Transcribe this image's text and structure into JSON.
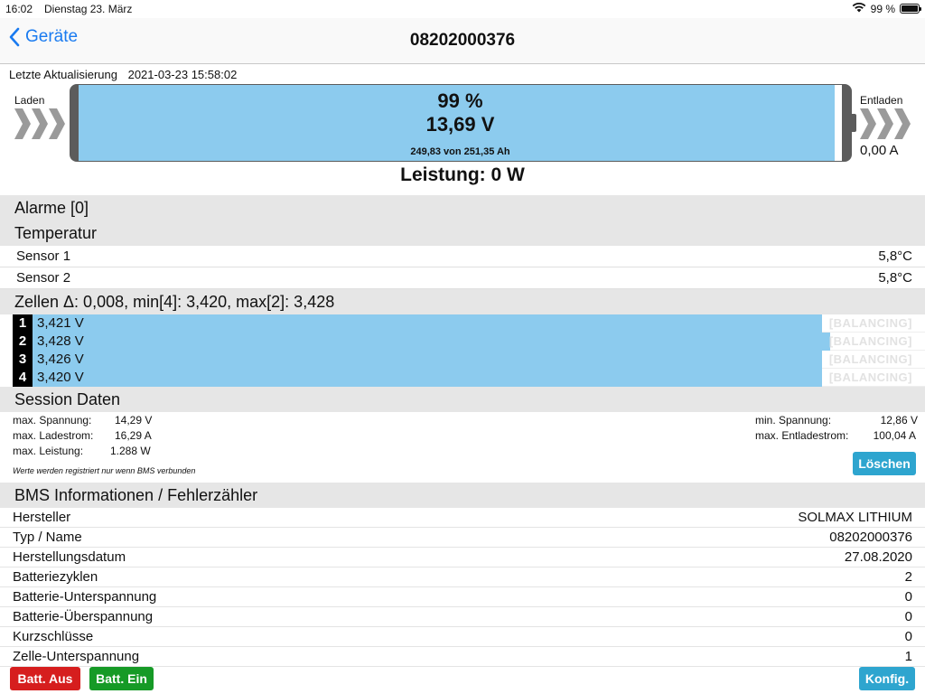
{
  "status_bar": {
    "time": "16:02",
    "date": "Dienstag 23. März",
    "battery_percent": "99 %",
    "icons": [
      "wifi-icon",
      "battery-icon"
    ]
  },
  "nav": {
    "back_label": "Geräte",
    "title": "08202000376"
  },
  "update": {
    "label": "Letzte Aktualisierung",
    "value": "2021-03-23 15:58:02"
  },
  "battery": {
    "charge_label": "Laden",
    "discharge_label": "Entladen",
    "discharge_current": "0,00 A",
    "percent_text": "99 %",
    "level": 0.99,
    "voltage": "13,69 V",
    "capacity": "249,83 von 251,35 Ah",
    "power": "Leistung: 0 W",
    "fill_color": "#8ccbee"
  },
  "alarms": {
    "title": "Alarme [0]"
  },
  "temperature": {
    "title": "Temperatur",
    "sensors": [
      {
        "name": "Sensor 1",
        "value": "5,8°C"
      },
      {
        "name": "Sensor 2",
        "value": "5,8°C"
      }
    ]
  },
  "cells": {
    "title": "Zellen Δ: 0,008, min[4]: 3,420, max[2]: 3,428",
    "balancing_label": "[BALANCING]",
    "items": [
      {
        "index": "1",
        "voltage": "3,421 V",
        "level": 0.885
      },
      {
        "index": "2",
        "voltage": "3,428 V",
        "level": 0.894
      },
      {
        "index": "3",
        "voltage": "3,426 V",
        "level": 0.885
      },
      {
        "index": "4",
        "voltage": "3,420 V",
        "level": 0.885
      }
    ]
  },
  "session": {
    "title": "Session Daten",
    "left": [
      {
        "label": "max. Spannung:",
        "value": "14,29 V"
      },
      {
        "label": "max. Ladestrom:",
        "value": "16,29 A"
      },
      {
        "label": "max. Leistung:",
        "value": "1.288 W"
      }
    ],
    "right": [
      {
        "label": "min. Spannung:",
        "value": "12,86 V"
      },
      {
        "label": "max. Entladestrom:",
        "value": "100,04 A"
      }
    ],
    "note": "Werte werden registriert nur wenn BMS verbunden",
    "clear_button": "Löschen"
  },
  "bms": {
    "title": "BMS Informationen / Fehlerzähler",
    "rows": [
      {
        "label": "Hersteller",
        "value": "SOLMAX LITHIUM"
      },
      {
        "label": "Typ / Name",
        "value": "08202000376"
      },
      {
        "label": "Herstellungsdatum",
        "value": "27.08.2020"
      },
      {
        "label": "Batteriezyklen",
        "value": "2"
      },
      {
        "label": "Batterie-Unterspannung",
        "value": "0"
      },
      {
        "label": "Batterie-Überspannung",
        "value": "0"
      },
      {
        "label": "Kurzschlüsse",
        "value": "0"
      },
      {
        "label": "Zelle-Unterspannung",
        "value": "1"
      }
    ]
  },
  "footer": {
    "batt_off": "Batt. Aus",
    "batt_on": "Batt. Ein",
    "config": "Konfig."
  }
}
